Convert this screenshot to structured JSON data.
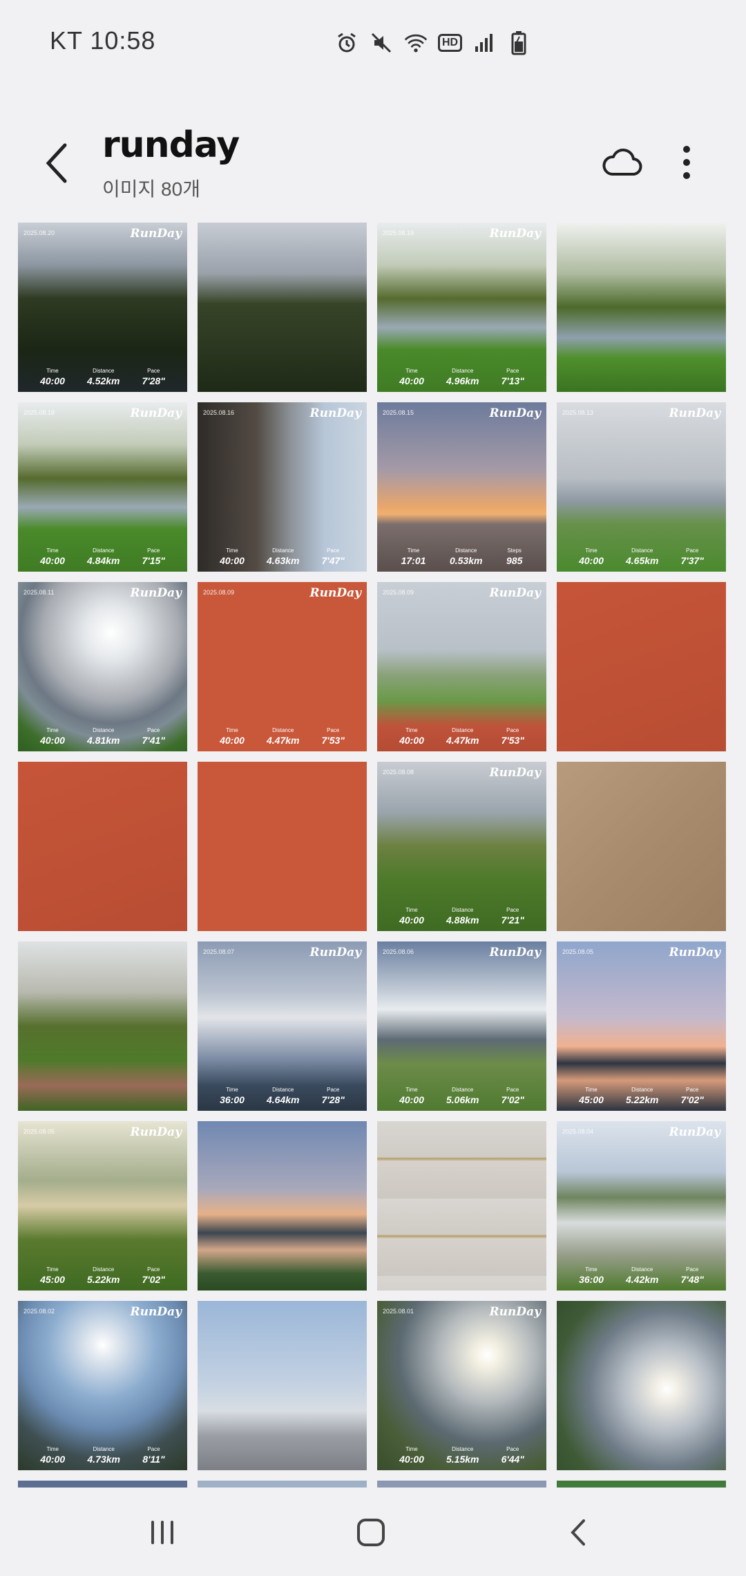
{
  "status": {
    "carrier_time": "KT 10:58",
    "icons": [
      "alarm-icon",
      "mute-icon",
      "wifi-icon",
      "hd-icon",
      "signal-icon",
      "battery-icon"
    ],
    "hd_label": "HD"
  },
  "header": {
    "title": "runday",
    "subtitle": "이미지 80개"
  },
  "tiles": [
    {
      "date": "2025.08.20",
      "brand": "RunDay",
      "stats": [
        {
          "l": "Time",
          "v": "40:00"
        },
        {
          "l": "Distance",
          "v": "4.52km"
        },
        {
          "l": "Pace",
          "v": "7'28\""
        }
      ]
    },
    {
      "date": "",
      "brand": "",
      "stats": []
    },
    {
      "date": "2025.08.19",
      "brand": "RunDay",
      "stats": [
        {
          "l": "Time",
          "v": "40:00"
        },
        {
          "l": "Distance",
          "v": "4.96km"
        },
        {
          "l": "Pace",
          "v": "7'13\""
        }
      ]
    },
    {
      "date": "",
      "brand": "",
      "stats": []
    },
    {
      "date": "2025.08.18",
      "brand": "RunDay",
      "stats": [
        {
          "l": "Time",
          "v": "40:00"
        },
        {
          "l": "Distance",
          "v": "4.84km"
        },
        {
          "l": "Pace",
          "v": "7'15\""
        }
      ]
    },
    {
      "date": "2025.08.16",
      "brand": "RunDay",
      "stats": [
        {
          "l": "Time",
          "v": "40:00"
        },
        {
          "l": "Distance",
          "v": "4.63km"
        },
        {
          "l": "Pace",
          "v": "7'47\""
        }
      ]
    },
    {
      "date": "2025.08.15",
      "brand": "RunDay",
      "stats": [
        {
          "l": "Time",
          "v": "17:01"
        },
        {
          "l": "Distance",
          "v": "0.53km"
        },
        {
          "l": "Steps",
          "v": "985"
        }
      ]
    },
    {
      "date": "2025.08.13",
      "brand": "RunDay",
      "stats": [
        {
          "l": "Time",
          "v": "40:00"
        },
        {
          "l": "Distance",
          "v": "4.65km"
        },
        {
          "l": "Pace",
          "v": "7'37\""
        }
      ]
    },
    {
      "date": "2025.08.11",
      "brand": "RunDay",
      "stats": [
        {
          "l": "Time",
          "v": "40:00"
        },
        {
          "l": "Distance",
          "v": "4.81km"
        },
        {
          "l": "Pace",
          "v": "7'41\""
        }
      ]
    },
    {
      "date": "2025.08.09",
      "brand": "RunDay",
      "stats": [
        {
          "l": "Time",
          "v": "40:00"
        },
        {
          "l": "Distance",
          "v": "4.47km"
        },
        {
          "l": "Pace",
          "v": "7'53\""
        }
      ]
    },
    {
      "date": "2025.08.09",
      "brand": "RunDay",
      "stats": [
        {
          "l": "Time",
          "v": "40:00"
        },
        {
          "l": "Distance",
          "v": "4.47km"
        },
        {
          "l": "Pace",
          "v": "7'53\""
        }
      ]
    },
    {
      "date": "",
      "brand": "",
      "stats": []
    },
    {
      "date": "",
      "brand": "",
      "stats": []
    },
    {
      "date": "",
      "brand": "",
      "stats": []
    },
    {
      "date": "2025.08.08",
      "brand": "RunDay",
      "stats": [
        {
          "l": "Time",
          "v": "40:00"
        },
        {
          "l": "Distance",
          "v": "4.88km"
        },
        {
          "l": "Pace",
          "v": "7'21\""
        }
      ]
    },
    {
      "date": "",
      "brand": "",
      "stats": []
    },
    {
      "date": "",
      "brand": "",
      "stats": []
    },
    {
      "date": "2025.08.07",
      "brand": "RunDay",
      "stats": [
        {
          "l": "Time",
          "v": "36:00"
        },
        {
          "l": "Distance",
          "v": "4.64km"
        },
        {
          "l": "Pace",
          "v": "7'28\""
        }
      ]
    },
    {
      "date": "2025.08.06",
      "brand": "RunDay",
      "stats": [
        {
          "l": "Time",
          "v": "40:00"
        },
        {
          "l": "Distance",
          "v": "5.06km"
        },
        {
          "l": "Pace",
          "v": "7'02\""
        }
      ]
    },
    {
      "date": "2025.08.05",
      "brand": "RunDay",
      "stats": [
        {
          "l": "Time",
          "v": "45:00"
        },
        {
          "l": "Distance",
          "v": "5.22km"
        },
        {
          "l": "Pace",
          "v": "7'02\""
        }
      ]
    },
    {
      "date": "2025.08.05",
      "brand": "RunDay",
      "stats": [
        {
          "l": "Time",
          "v": "45:00"
        },
        {
          "l": "Distance",
          "v": "5.22km"
        },
        {
          "l": "Pace",
          "v": "7'02\""
        }
      ]
    },
    {
      "date": "",
      "brand": "",
      "stats": []
    },
    {
      "date": "",
      "brand": "",
      "stats": []
    },
    {
      "date": "2025.08.04",
      "brand": "RunDay",
      "stats": [
        {
          "l": "Time",
          "v": "36:00"
        },
        {
          "l": "Distance",
          "v": "4.42km"
        },
        {
          "l": "Pace",
          "v": "7'48\""
        }
      ]
    },
    {
      "date": "2025.08.02",
      "brand": "RunDay",
      "stats": [
        {
          "l": "Time",
          "v": "40:00"
        },
        {
          "l": "Distance",
          "v": "4.73km"
        },
        {
          "l": "Pace",
          "v": "8'11\""
        }
      ]
    },
    {
      "date": "",
      "brand": "",
      "stats": []
    },
    {
      "date": "2025.08.01",
      "brand": "RunDay",
      "stats": [
        {
          "l": "Time",
          "v": "40:00"
        },
        {
          "l": "Distance",
          "v": "5.15km"
        },
        {
          "l": "Pace",
          "v": "6'44\""
        }
      ]
    },
    {
      "date": "",
      "brand": "",
      "stats": []
    },
    {
      "date": "",
      "brand": "",
      "stats": []
    },
    {
      "date": "",
      "brand": "",
      "stats": []
    },
    {
      "date": "",
      "brand": "",
      "stats": []
    },
    {
      "date": "",
      "brand": "",
      "stats": []
    }
  ],
  "tile_styles": [
    "bg-dark-tree",
    "bg-dark-tree2",
    "bg-willow",
    "bg-willow2",
    "bg-willow",
    "bg-cafe",
    "bg-sunset-beach",
    "bg-grey-sky-tree",
    "bg-cloud-sun",
    "bg-track",
    "bg-track-path",
    "bg-track2",
    "bg-track2",
    "bg-track",
    "bg-green-field",
    "bg-dirt",
    "bg-tree-field",
    "bg-clouds",
    "bg-sun-river",
    "bg-pink-sunset",
    "bg-golden-tree",
    "bg-dusk-lake",
    "bg-stairs",
    "bg-weir",
    "bg-sun-tree2",
    "bg-street",
    "bg-sun-field",
    "bg-sun-field2",
    "bg-partial",
    "bg-partial2",
    "bg-partial3",
    "bg-partial4"
  ],
  "nav": {
    "icons": [
      "recents-icon",
      "home-icon",
      "back-icon"
    ]
  }
}
